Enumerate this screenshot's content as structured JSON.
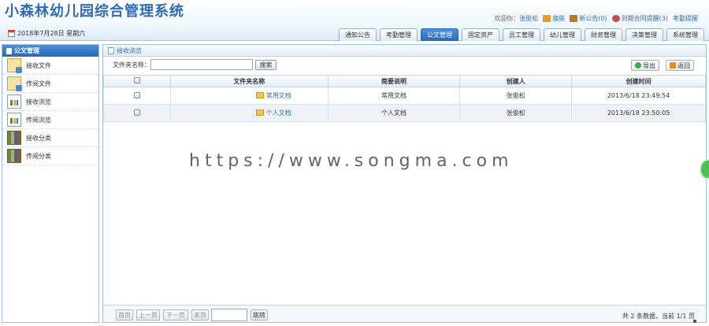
{
  "header": {
    "app_title": "小森林幼儿园综合管理系统",
    "welcome_prefix": "欢迎你：",
    "username": "张俊松",
    "links": [
      {
        "label": "换肤",
        "icon": "skin-icon",
        "color": "#e0a020"
      },
      {
        "label": "新公告(0)",
        "icon": "notice-icon",
        "color": "#b57b2a"
      },
      {
        "label": "到期合同提醒(3)",
        "icon": "contract-icon",
        "color": "#c0504d"
      },
      {
        "label": "考勤提醒",
        "icon": "attendance-icon",
        "color": "#2e6db5"
      }
    ],
    "date": "2018年7月28日 星期六"
  },
  "tabs": [
    {
      "label": "通知公告",
      "active": false
    },
    {
      "label": "考勤管理",
      "active": false
    },
    {
      "label": "公文管理",
      "active": true
    },
    {
      "label": "固定资产",
      "active": false
    },
    {
      "label": "员工管理",
      "active": false
    },
    {
      "label": "幼儿管理",
      "active": false
    },
    {
      "label": "财务管理",
      "active": false
    },
    {
      "label": "决策管理",
      "active": false
    },
    {
      "label": "系统管理",
      "active": false
    }
  ],
  "sidebar": {
    "title": "公文管理",
    "items": [
      {
        "label": "接收文件",
        "icon": "receive-file-icon"
      },
      {
        "label": "传阅文件",
        "icon": "circulate-file-icon"
      },
      {
        "label": "接收浏览",
        "icon": "receive-browse-icon"
      },
      {
        "label": "传阅浏览",
        "icon": "circulate-browse-icon"
      },
      {
        "label": "接收分类",
        "icon": "receive-category-icon"
      },
      {
        "label": "传阅分类",
        "icon": "circulate-category-icon"
      }
    ]
  },
  "main": {
    "breadcrumb": "接收浏览",
    "search": {
      "label": "文件夹名称：",
      "value": "",
      "button": "搜索"
    },
    "actions": {
      "export": "导出",
      "back": "返回"
    },
    "columns": [
      "文件夹名称",
      "简要说明",
      "创建人",
      "创建时间"
    ],
    "rows": [
      {
        "name": "常用文档",
        "desc": "常用文档",
        "creator": "张俊松",
        "created": "2013/6/18 23:49:54"
      },
      {
        "name": "个人文档",
        "desc": "个人文档",
        "creator": "张俊松",
        "created": "2013/6/18 23:50:05"
      }
    ],
    "pager": {
      "first": "首页",
      "prev": "上一页",
      "next": "下一页",
      "last": "末页",
      "jump": "跳转",
      "page_input": "",
      "info": "共 2 条数据，当前 1/1 页"
    }
  },
  "watermark": "https://www.songma.com"
}
